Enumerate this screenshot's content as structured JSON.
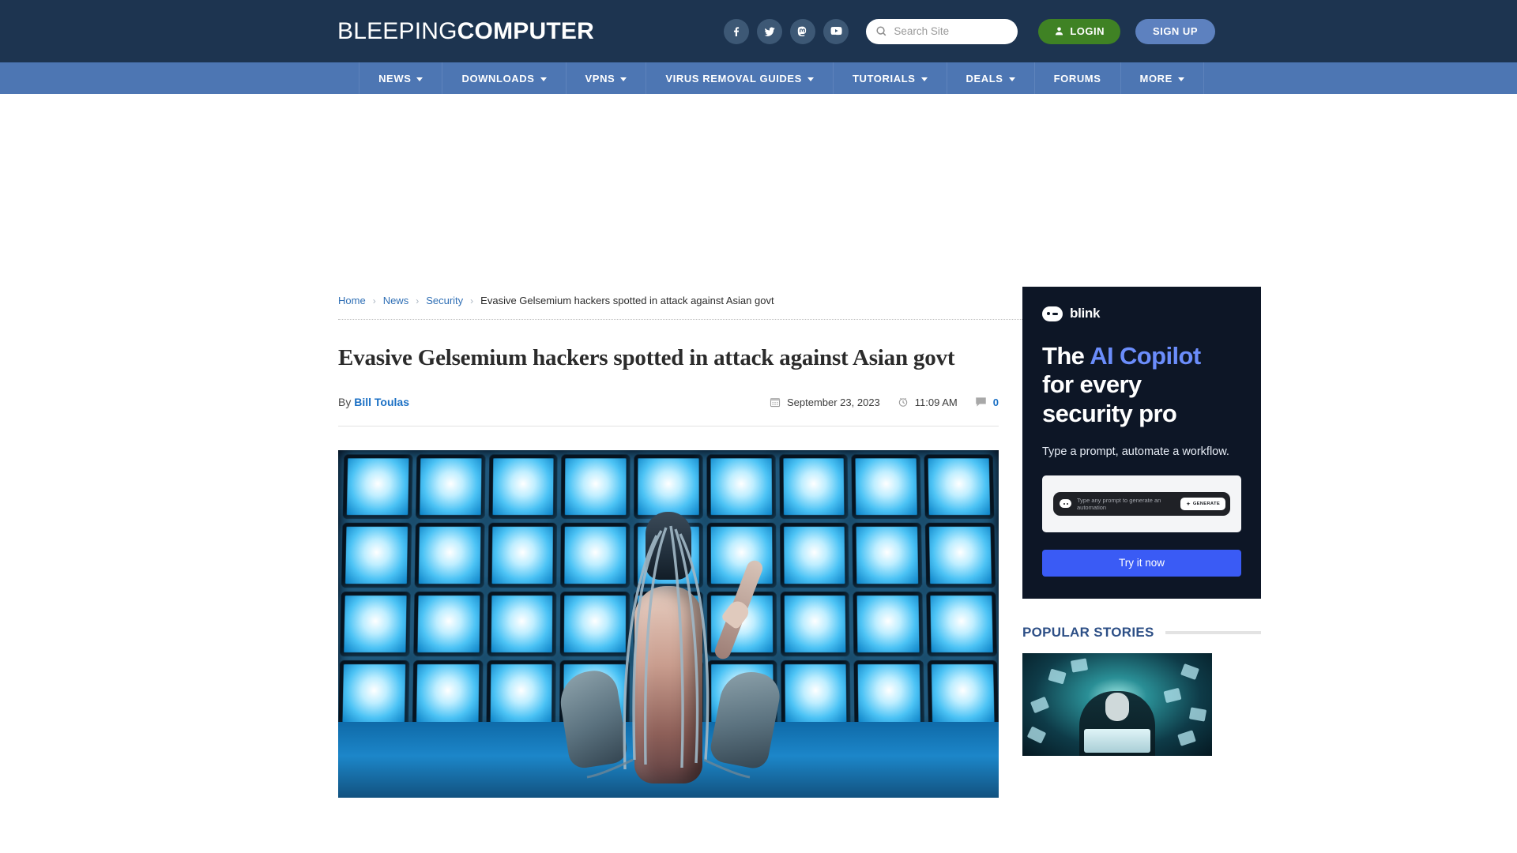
{
  "site": {
    "logo_light": "BLEEPING",
    "logo_bold": "COMPUTER"
  },
  "header": {
    "social": [
      {
        "name": "facebook-icon",
        "label": "Facebook"
      },
      {
        "name": "twitter-icon",
        "label": "Twitter"
      },
      {
        "name": "mastodon-icon",
        "label": "Mastodon"
      },
      {
        "name": "youtube-icon",
        "label": "YouTube"
      }
    ],
    "search_placeholder": "Search Site",
    "search_value": "",
    "login_label": "LOGIN",
    "signup_label": "SIGN UP",
    "bg_color": "#1d3450"
  },
  "nav": {
    "bg_color": "#4d76b3",
    "items": [
      {
        "label": "NEWS",
        "has_dropdown": true
      },
      {
        "label": "DOWNLOADS",
        "has_dropdown": true
      },
      {
        "label": "VPNS",
        "has_dropdown": true
      },
      {
        "label": "VIRUS REMOVAL GUIDES",
        "has_dropdown": true
      },
      {
        "label": "TUTORIALS",
        "has_dropdown": true
      },
      {
        "label": "DEALS",
        "has_dropdown": true
      },
      {
        "label": "FORUMS",
        "has_dropdown": false
      },
      {
        "label": "MORE",
        "has_dropdown": true
      }
    ]
  },
  "breadcrumb": {
    "items": [
      "Home",
      "News",
      "Security"
    ],
    "current": "Evasive Gelsemium hackers spotted in attack against Asian govt",
    "separator": "›"
  },
  "article": {
    "title": "Evasive Gelsemium hackers spotted in attack against Asian govt",
    "by_prefix": "By",
    "author": "Bill Toulas",
    "date": "September 23, 2023",
    "time": "11:09 AM",
    "comments": "0",
    "hero_alt": "Cyborg figure kneeling before a wall of glowing blue television screens"
  },
  "sidebar": {
    "ad": {
      "brand": "blink",
      "headline_1": "The ",
      "headline_accent": "AI Copilot",
      "headline_2": "for every",
      "headline_3": "security pro",
      "subtitle": "Type a prompt, automate a workflow.",
      "prompt_placeholder": "Type any prompt to generate an automation",
      "generate_label": "GENERATE",
      "cta_label": "Try it now",
      "bg_color": "#0d1626",
      "accent_color": "#6b8dfb",
      "cta_color": "#3a5bf5"
    },
    "popular": {
      "heading": "POPULAR STORIES",
      "thumb_alt": "Hooded hacker at a laptop surrounded by flying documents"
    }
  }
}
